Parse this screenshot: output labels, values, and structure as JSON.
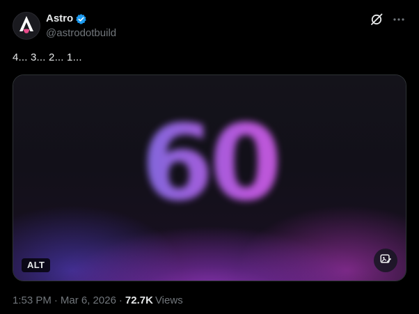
{
  "author": {
    "display_name": "Astro",
    "handle": "@astrodotbuild",
    "verified": true,
    "avatar_icon": "astro-logo-icon"
  },
  "actions": {
    "grok_icon": "grok-icon",
    "more_icon": "more-options-icon"
  },
  "post": {
    "text": "4... 3... 2... 1..."
  },
  "media": {
    "digits_text": "60",
    "alt_label": "ALT",
    "edit_icon": "edit-image-icon"
  },
  "meta": {
    "time": "1:53 PM",
    "separator": "·",
    "date": "Mar 6, 2026",
    "views_count": "72.7K",
    "views_label": "Views"
  },
  "colors": {
    "background": "#000000",
    "text_primary": "#e7e9ea",
    "text_secondary": "#71767b",
    "verified_blue": "#1d9bf0",
    "astro_accent": "#e84b8a"
  }
}
